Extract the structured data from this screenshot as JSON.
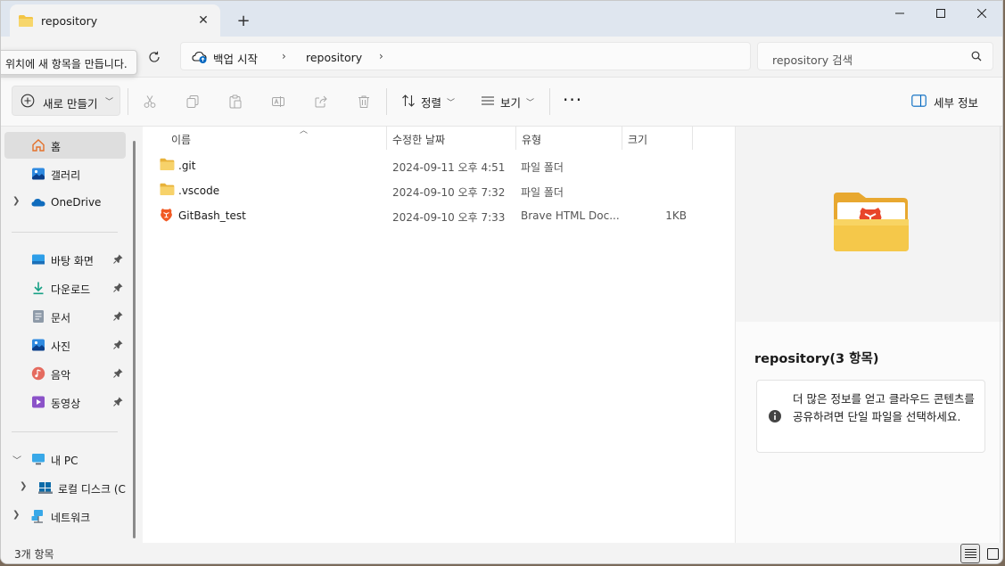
{
  "window": {
    "tab_title": "repository",
    "new_tab": "+",
    "close_tab": "✕"
  },
  "tooltip": "위치에 새 항목을 만듭니다.",
  "address": {
    "crumbs": [
      "백업 시작",
      "repository"
    ],
    "separator": "›"
  },
  "search": {
    "placeholder": "repository 검색"
  },
  "toolbar": {
    "new_label": "새로 만들기",
    "sort_label": "정렬",
    "view_label": "보기",
    "more_label": "···",
    "details_label": "세부 정보"
  },
  "sidebar": {
    "home": "홈",
    "gallery": "갤러리",
    "onedrive": "OneDrive",
    "quick": [
      {
        "label": "바탕 화면",
        "icon": "desktop-icon"
      },
      {
        "label": "다운로드",
        "icon": "download-icon"
      },
      {
        "label": "문서",
        "icon": "document-icon"
      },
      {
        "label": "사진",
        "icon": "pictures-icon"
      },
      {
        "label": "음악",
        "icon": "music-icon"
      },
      {
        "label": "동영상",
        "icon": "video-icon"
      }
    ],
    "this_pc": "내 PC",
    "local_disk": "로컬 디스크 (C",
    "network": "네트워크"
  },
  "columns": {
    "name": "이름",
    "modified": "수정한 날짜",
    "type": "유형",
    "size": "크기"
  },
  "files": [
    {
      "name": ".git",
      "modified": "2024-09-11 오후 4:51",
      "type": "파일 폴더",
      "size": "",
      "icon": "folder-icon"
    },
    {
      "name": ".vscode",
      "modified": "2024-09-10 오후 7:32",
      "type": "파일 폴더",
      "size": "",
      "icon": "folder-icon"
    },
    {
      "name": "GitBash_test",
      "modified": "2024-09-10 오후 7:33",
      "type": "Brave HTML Doc...",
      "size": "1KB",
      "icon": "brave-html-icon"
    }
  ],
  "details": {
    "title": "repository(3 항목)",
    "info": "더 많은 정보를 얻고 클라우드 콘텐츠를 공유하려면 단일 파일을 선택하세요."
  },
  "status": {
    "count": "3개 항목"
  },
  "colors": {
    "accent": "#0067c0",
    "folder": "#f3c545",
    "brave": "#f15a24"
  }
}
